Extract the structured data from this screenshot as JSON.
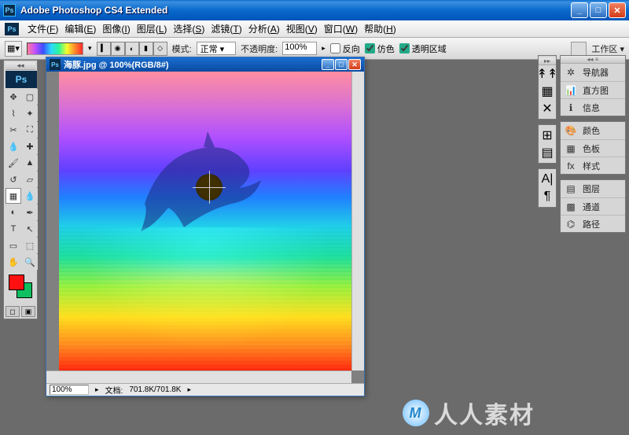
{
  "titlebar": {
    "title": "Adobe Photoshop CS4 Extended"
  },
  "menu": {
    "items": [
      {
        "label": "文件",
        "key": "F"
      },
      {
        "label": "编辑",
        "key": "E"
      },
      {
        "label": "图像",
        "key": "I"
      },
      {
        "label": "图层",
        "key": "L"
      },
      {
        "label": "选择",
        "key": "S"
      },
      {
        "label": "滤镜",
        "key": "T"
      },
      {
        "label": "分析",
        "key": "A"
      },
      {
        "label": "视图",
        "key": "V"
      },
      {
        "label": "窗口",
        "key": "W"
      },
      {
        "label": "帮助",
        "key": "H"
      }
    ]
  },
  "options": {
    "mode_label": "模式:",
    "mode_value": "正常",
    "opacity_label": "不透明度:",
    "opacity_value": "100%",
    "reverse_label": "反向",
    "reverse_checked": false,
    "dither_label": "仿色",
    "dither_checked": true,
    "transp_label": "透明区域",
    "transp_checked": true,
    "workspace_label": "工作区"
  },
  "document": {
    "title": "海豚.jpg @ 100%(RGB/8#)",
    "zoom": "100%",
    "status_label": "文档:",
    "status_value": "701.8K/701.8K"
  },
  "panels": {
    "group1": [
      {
        "icon": "navigator-icon",
        "label": "导航器"
      },
      {
        "icon": "histogram-icon",
        "label": "直方图"
      },
      {
        "icon": "info-icon",
        "label": "信息"
      }
    ],
    "group2": [
      {
        "icon": "color-icon",
        "label": "颜色"
      },
      {
        "icon": "swatches-icon",
        "label": "色板"
      },
      {
        "icon": "styles-icon",
        "label": "样式"
      }
    ],
    "group3": [
      {
        "icon": "layers-icon",
        "label": "图层"
      },
      {
        "icon": "channels-icon",
        "label": "通道"
      },
      {
        "icon": "paths-icon",
        "label": "路径"
      }
    ]
  },
  "colors": {
    "fg": "#ff1010",
    "bg": "#10c060"
  },
  "watermark": {
    "text": "人人素材",
    "logo": "M"
  }
}
